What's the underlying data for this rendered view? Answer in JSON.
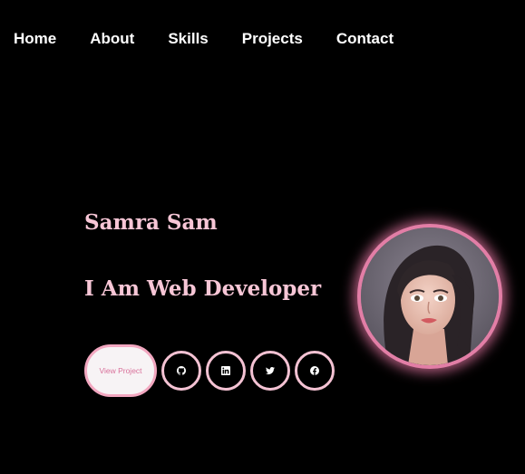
{
  "nav": {
    "items": [
      {
        "label": "Home"
      },
      {
        "label": "About"
      },
      {
        "label": "Skills"
      },
      {
        "label": "Projects"
      },
      {
        "label": "Contact"
      }
    ]
  },
  "hero": {
    "name": "Samra Sam",
    "role": "I Am Web Developer",
    "view_button": "View Project",
    "socials": [
      {
        "icon": "github-icon"
      },
      {
        "icon": "linkedin-icon"
      },
      {
        "icon": "twitter-icon"
      },
      {
        "icon": "facebook-icon"
      }
    ]
  },
  "colors": {
    "background": "#000000",
    "accent_pink": "#f7c6d6",
    "avatar_ring": "#e27ea6"
  }
}
